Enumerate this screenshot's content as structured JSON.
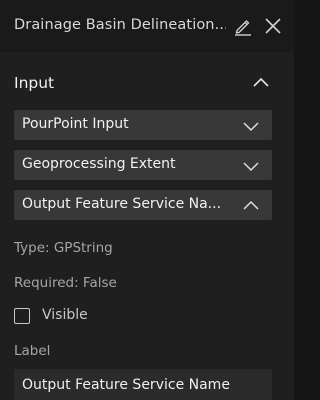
{
  "header": {
    "title": "Drainage Basin Delineation...",
    "edit_icon": "pencil-icon",
    "close_icon": "close-icon"
  },
  "input_section": {
    "title": "Input",
    "expanded": true,
    "items": [
      {
        "label": "PourPoint Input",
        "expanded": false
      },
      {
        "label": "Geoprocessing Extent",
        "expanded": false
      },
      {
        "label": "Output Feature Service Na...",
        "expanded": true
      }
    ]
  },
  "param_details": {
    "type_text": "Type: GPString",
    "required_text": "Required: False",
    "visible_label": "Visible",
    "visible_checked": false,
    "label_field_label": "Label",
    "label_value": "Output Feature Service Name"
  },
  "colors": {
    "background": "#1f1f1f",
    "header": "#1a1a1a",
    "accordion_item": "#383838",
    "input": "#2b2b2b",
    "text": "#f0f0f0",
    "muted_text": "#a6a6a6"
  }
}
